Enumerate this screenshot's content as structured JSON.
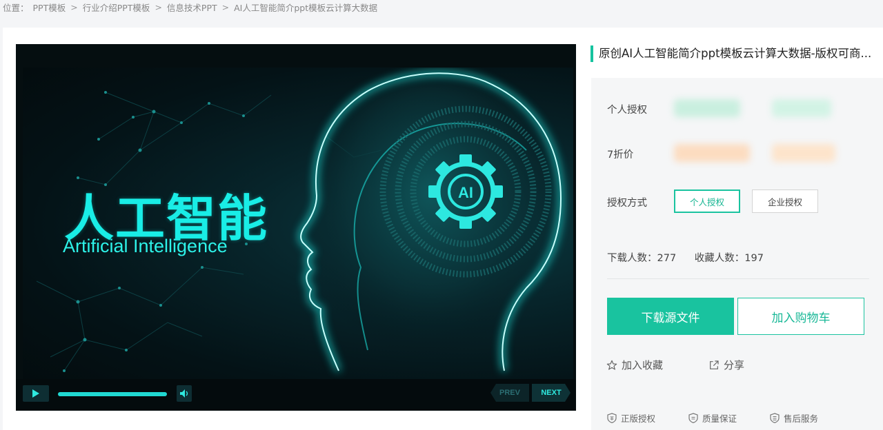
{
  "breadcrumb": {
    "prefix": "位置：",
    "items": [
      "PPT模板",
      "行业介绍PPT模板",
      "信息技术PPT",
      "AI人工智能简介ppt模板云计算大数据"
    ],
    "separator": ">"
  },
  "slide": {
    "title_cn": "人工智能",
    "title_en": "Artificial Intelligence",
    "gear_label": "AI",
    "accent_color": "#19ede6"
  },
  "player": {
    "progress": 1.0,
    "prev_label": "PREV",
    "next_label": "NEXT",
    "play_icon": "play-icon",
    "volume_icon": "volume-icon"
  },
  "product": {
    "title": "原创AI人工智能简介ppt模板云计算大数据-版权可商..."
  },
  "pricing": {
    "personal_license_label": "个人授权",
    "discount_label": "7折价"
  },
  "license": {
    "label": "授权方式",
    "options": [
      "个人授权",
      "企业授权"
    ],
    "selected": "个人授权"
  },
  "stats": {
    "downloads_label": "下载人数：",
    "downloads": "277",
    "favorites_label": "收藏人数：",
    "favorites": "197"
  },
  "actions": {
    "download": "下载源文件",
    "cart": "加入购物车",
    "favorite": "加入收藏",
    "share": "分享"
  },
  "guarantees": [
    "正版授权",
    "质量保证",
    "售后服务"
  ],
  "colors": {
    "brand": "#19c39f",
    "slide_cyan": "#19ede6"
  }
}
